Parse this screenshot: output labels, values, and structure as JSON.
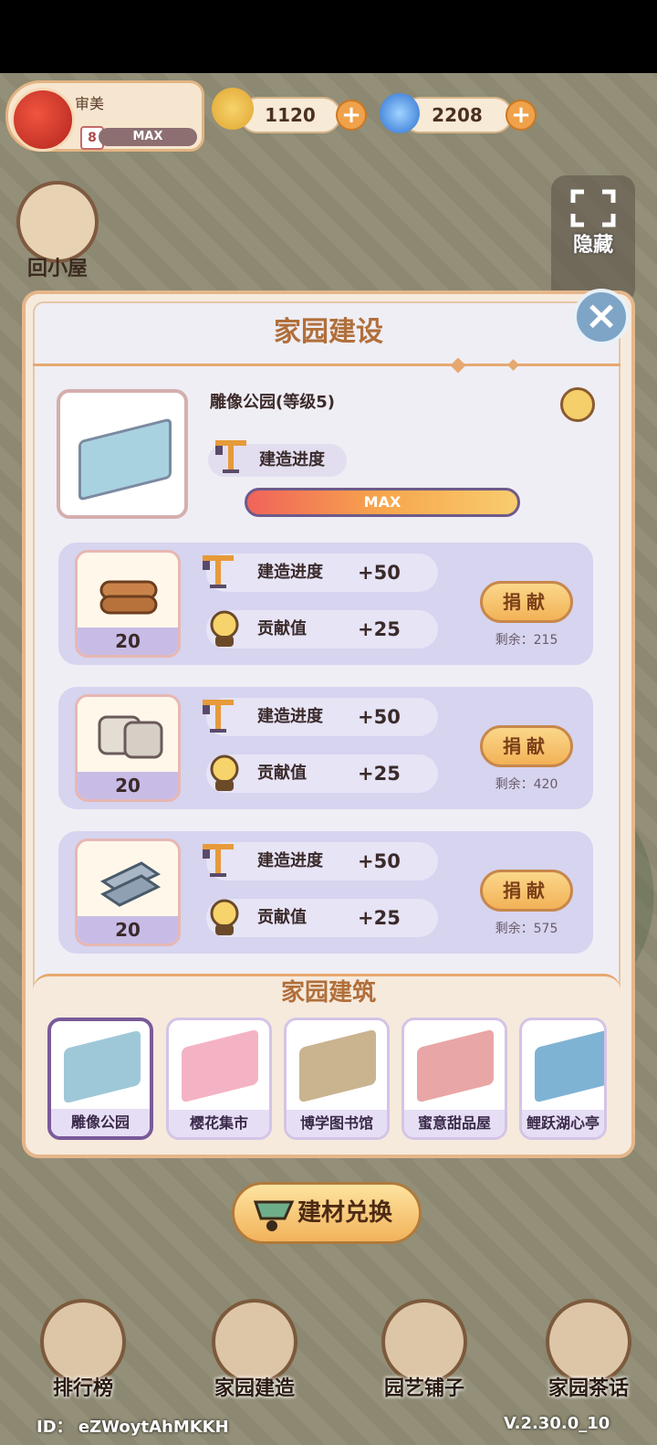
{
  "player": {
    "name": "审美",
    "level": "8",
    "level_status": "MAX"
  },
  "resources": [
    {
      "icon": "snail-coin-icon",
      "value": "1120"
    },
    {
      "icon": "swirl-gem-icon",
      "value": "2208"
    }
  ],
  "side": {
    "home_label": "回小屋",
    "hide_label": "隐藏"
  },
  "dialog": {
    "title": "家园建设",
    "building_name": "雕像公园(等级5)",
    "progress_label": "建造进度",
    "progress_text": "MAX",
    "progress_fraction": 1.0
  },
  "materials": [
    {
      "icon": "wood-logs-icon",
      "count": "20",
      "progress_label": "建造进度",
      "progress_value": "+50",
      "contrib_label": "贡献值",
      "contrib_value": "+25",
      "button": "捐献",
      "remain": "剩余：215"
    },
    {
      "icon": "cement-bags-icon",
      "count": "20",
      "progress_label": "建造进度",
      "progress_value": "+50",
      "contrib_label": "贡献值",
      "contrib_value": "+25",
      "button": "捐献",
      "remain": "剩余：420"
    },
    {
      "icon": "steel-beams-icon",
      "count": "20",
      "progress_label": "建造进度",
      "progress_value": "+50",
      "contrib_label": "贡献值",
      "contrib_value": "+25",
      "button": "捐献",
      "remain": "剩余：575"
    }
  ],
  "buildings_section": {
    "title": "家园建筑",
    "items": [
      {
        "name": "雕像公园",
        "color": "#9ec8d8",
        "selected": true
      },
      {
        "name": "樱花集市",
        "color": "#f4b3c4",
        "selected": false
      },
      {
        "name": "博学图书馆",
        "color": "#c9b48f",
        "selected": false
      },
      {
        "name": "蜜意甜品屋",
        "color": "#e9a6a6",
        "selected": false
      },
      {
        "name": "鲤跃湖心亭",
        "color": "#7fb3d4",
        "selected": false
      }
    ]
  },
  "exchange_label": "建材兑换",
  "nav": [
    {
      "label": "排行榜",
      "icon": "trophy-icon"
    },
    {
      "label": "家园建造",
      "icon": "bricks-icon"
    },
    {
      "label": "园艺铺子",
      "icon": "flower-basket-icon"
    },
    {
      "label": "家园茶话",
      "icon": "chat-bubbles-icon"
    }
  ],
  "footer": {
    "id": "ID：  eZWoytAhMKKH",
    "version": "V.2.30.0_10"
  }
}
